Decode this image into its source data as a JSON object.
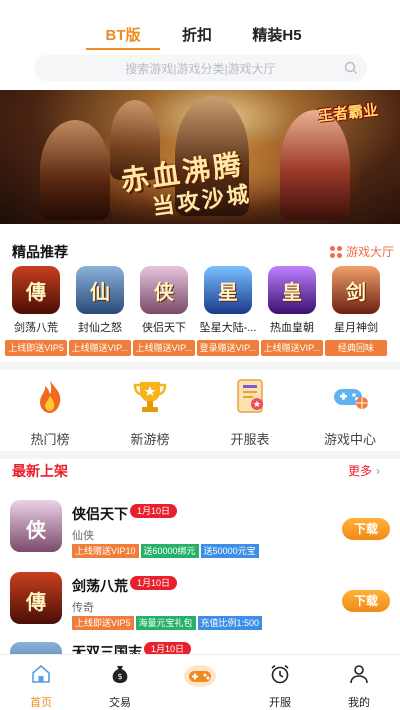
{
  "top_tabs": [
    {
      "label": "BT版",
      "active": true
    },
    {
      "label": "折扣",
      "active": false
    },
    {
      "label": "精装H5",
      "active": false
    }
  ],
  "search": {
    "placeholder": "搜索游戏|游戏分类|游戏大厅"
  },
  "banner": {
    "title_line1": "赤血沸腾",
    "title_line2": "当攻沙城",
    "logo_text": "王者霸业"
  },
  "featured": {
    "title": "精品推荐",
    "more_label": "游戏大厅",
    "games": [
      {
        "name": "剑荡八荒",
        "tag": "上线即送VIP5",
        "icon": "傳",
        "color": "#7a1d10"
      },
      {
        "name": "封仙之怒",
        "tag": "上线赠送VIP...",
        "icon": "仙",
        "color": "#4a6e9a"
      },
      {
        "name": "侠侣天下",
        "tag": "上线赠送VIP...",
        "icon": "侠",
        "color": "#9a6a8a"
      },
      {
        "name": "坠星大陆-...",
        "tag": "登录赠送VIP...",
        "icon": "星",
        "color": "#2a5aa8"
      },
      {
        "name": "热血皇朝",
        "tag": "上线赠送VIP...",
        "icon": "皇",
        "color": "#7a3ab0"
      },
      {
        "name": "星月神剑",
        "tag": "经典回味",
        "icon": "剑",
        "color": "#a8462a"
      }
    ]
  },
  "quick_menu": [
    {
      "label": "热门榜",
      "icon": "flame-icon"
    },
    {
      "label": "新游榜",
      "icon": "trophy-icon"
    },
    {
      "label": "开服表",
      "icon": "server-list-icon"
    },
    {
      "label": "游戏中心",
      "icon": "gamepad-icon"
    }
  ],
  "latest": {
    "title": "最新上架",
    "more_label": "更多",
    "items": [
      {
        "name": "侠侣天下",
        "date": "1月10日",
        "category": "仙侠",
        "tags": [
          {
            "text": "上线赠送VIP10",
            "color": "#f07d3a"
          },
          {
            "text": "送60000绑元",
            "color": "#27b06a"
          },
          {
            "text": "送50000元宝",
            "color": "#3d8fe6"
          }
        ],
        "button": "下载",
        "icon": "侠",
        "color": "#9a6a8a"
      },
      {
        "name": "剑荡八荒",
        "date": "1月10日",
        "category": "传奇",
        "tags": [
          {
            "text": "上线即送VIP5",
            "color": "#f07d3a"
          },
          {
            "text": "海量元宝礼包",
            "color": "#27b06a"
          },
          {
            "text": "充值比例1:500",
            "color": "#3d8fe6"
          }
        ],
        "button": "下载",
        "icon": "傳",
        "color": "#7a1d10"
      },
      {
        "name": "无双三国志",
        "date": "1月10日",
        "category": "",
        "tags": [],
        "button": "",
        "icon": "三",
        "color": "#4a6e9a"
      }
    ]
  },
  "bottom_nav": [
    {
      "label": "首页",
      "icon": "home-icon",
      "active": true
    },
    {
      "label": "交易",
      "icon": "money-bag-icon",
      "active": false
    },
    {
      "label": "",
      "icon": "game-center-icon",
      "active": false
    },
    {
      "label": "开服",
      "icon": "alarm-clock-icon",
      "active": false
    },
    {
      "label": "我的",
      "icon": "user-icon",
      "active": false
    }
  ],
  "colors": {
    "accent": "#f08a24",
    "date_badge": "#e8202c",
    "tag_orange": "#f07d3a",
    "tag_green": "#27b06a",
    "tag_blue": "#3d8fe6"
  }
}
